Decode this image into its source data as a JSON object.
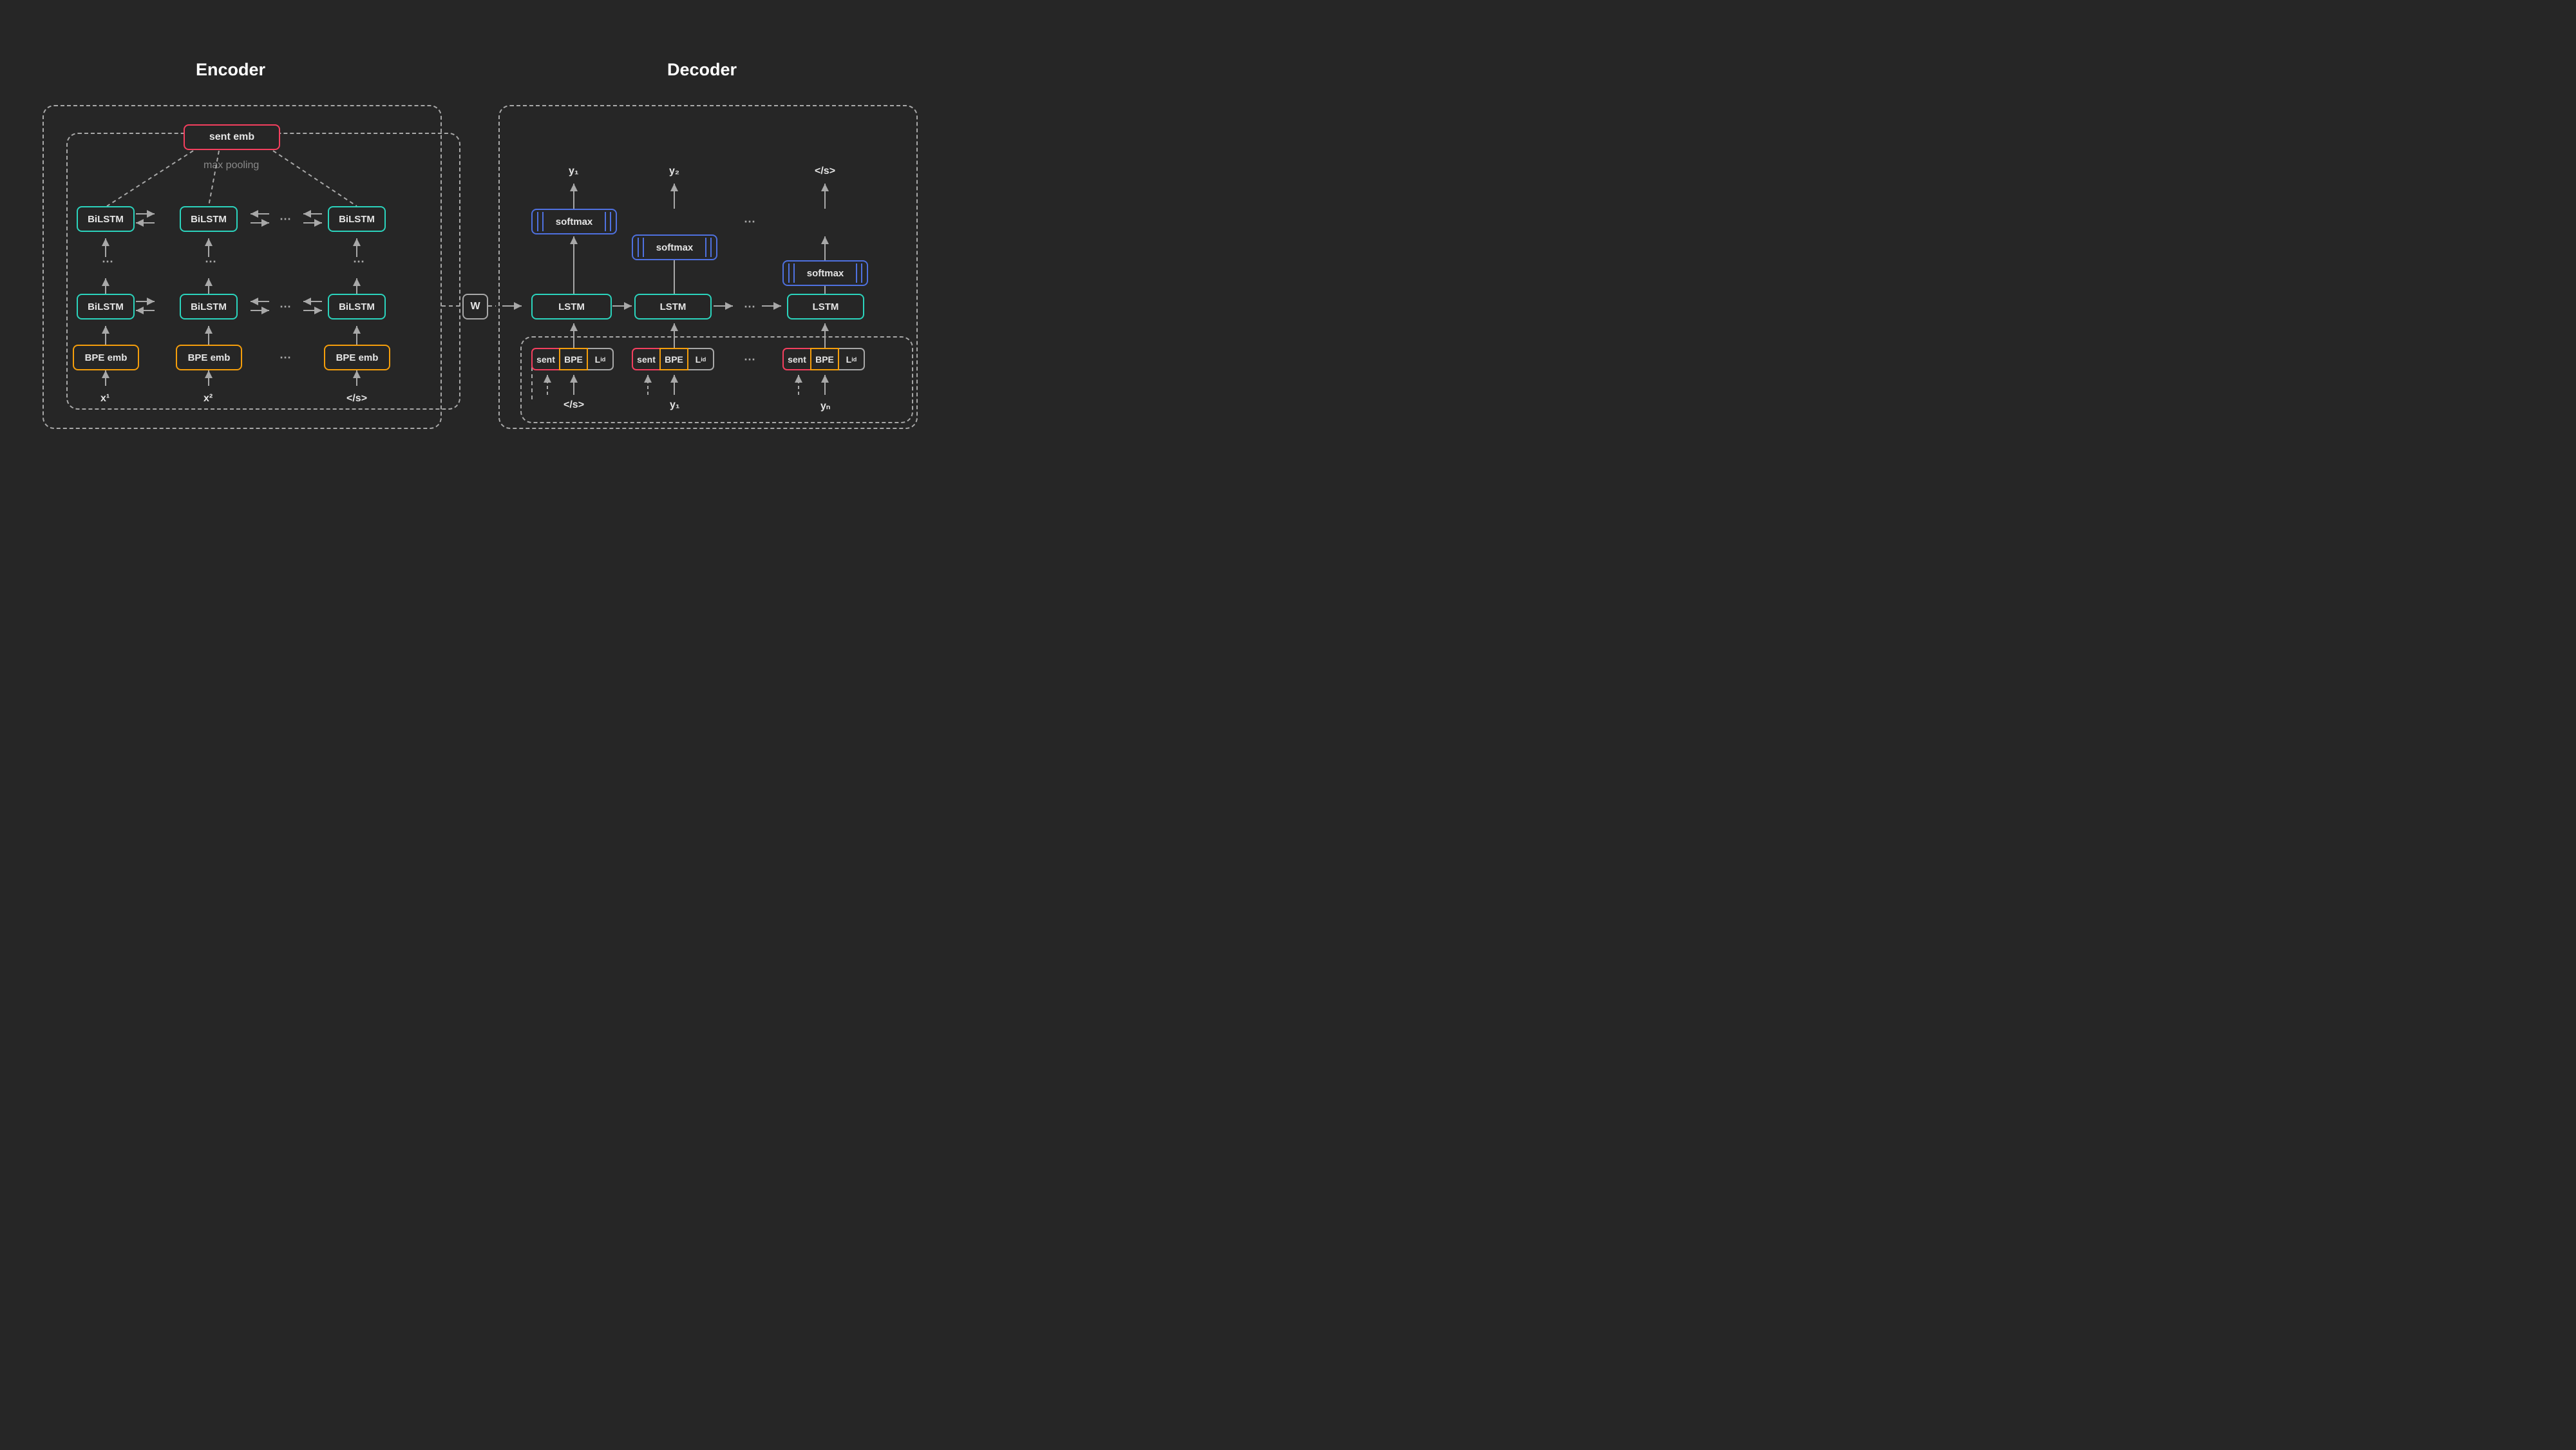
{
  "titles": {
    "encoder": "Encoder",
    "decoder": "Decoder"
  },
  "encoder": {
    "sent_emb": "sent emb",
    "max_pooling": "max pooling",
    "bilstm": "BiLSTM",
    "bpe_emb": "BPE emb",
    "inputs": {
      "x1": "x¹",
      "x2": "x²",
      "eos": "</s>"
    }
  },
  "w": "W",
  "decoder": {
    "softmax": "softmax",
    "lstm": "LSTM",
    "outputs": {
      "y1": "y₁",
      "y2": "y₂",
      "eos": "</s>"
    },
    "inputs": {
      "eos": "</s>",
      "y1": "y₁",
      "yn": "yₙ"
    },
    "seg": {
      "sent": "sent",
      "bpe": "BPE",
      "lid_prefix": "L",
      "lid_suffix": "id"
    }
  },
  "ellipsis": "⋯"
}
